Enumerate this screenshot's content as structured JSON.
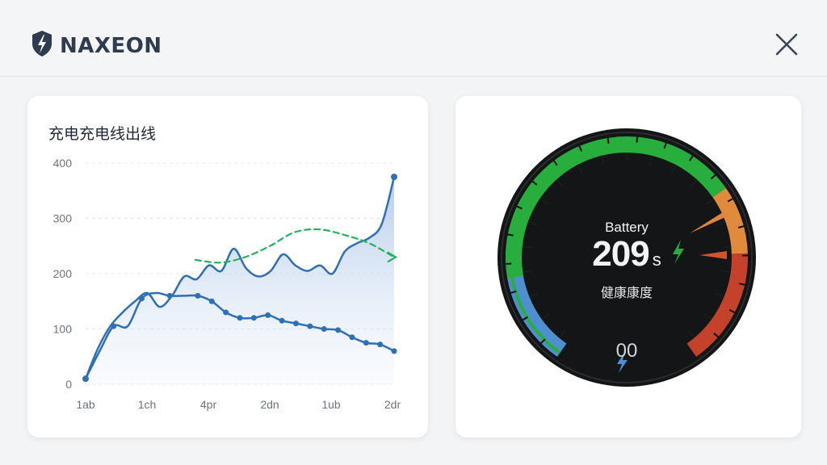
{
  "brand": {
    "name": "NAXEON"
  },
  "chart_card": {
    "title": "充电充电线出线"
  },
  "chart_data": {
    "type": "line",
    "categories": [
      "1ab",
      "1ch",
      "4pr",
      "2dn",
      "1ub",
      "2dr"
    ],
    "ylim": [
      0,
      400
    ],
    "yticks": [
      0,
      100,
      200,
      300,
      400
    ],
    "series": [
      {
        "values": [
          10,
          65,
          105,
          130,
          150,
          165,
          140,
          160,
          195,
          190,
          215,
          205,
          245,
          210,
          195,
          205,
          235,
          215,
          205,
          215,
          200,
          240,
          255,
          265,
          290,
          375
        ],
        "color": "#2f6fb3"
      },
      {
        "values": [
          10,
          60,
          105,
          105,
          155,
          165,
          160,
          160,
          160,
          150,
          130,
          120,
          120,
          125,
          115,
          110,
          105,
          100,
          98,
          85,
          75,
          72,
          60
        ],
        "color": "#2f6fb3"
      },
      {
        "values": [
          225,
          220,
          230,
          250,
          275,
          280,
          270,
          255,
          230
        ],
        "color": "#22b35a"
      }
    ]
  },
  "gauge": {
    "title": "Battery",
    "value": "209",
    "unit": "s",
    "subtitle": "健康康度",
    "bottom_value": "00",
    "colors": {
      "green": "#27ae3c",
      "blue": "#4f8fd0",
      "orange": "#e08a3c",
      "red": "#c4412c",
      "dial": "#141516"
    }
  }
}
